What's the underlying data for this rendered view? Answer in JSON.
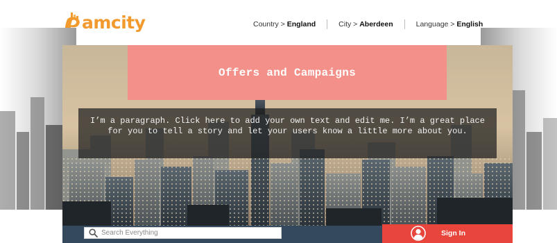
{
  "brand": {
    "logo_text": "amcity",
    "logo_initial": "P",
    "color": "#f29a2e"
  },
  "topnav": {
    "country": {
      "label": "Country > ",
      "value": "England"
    },
    "city": {
      "label": "City > ",
      "value": "Aberdeen"
    },
    "language": {
      "label": "Language > ",
      "value": "English"
    }
  },
  "hero": {
    "title": "Offers and Campaigns",
    "paragraph": "I’m a paragraph. Click here to add your own text and edit me. I’m a great place for you to tell a story and let your users know a little more about you.",
    "banner_color": "#f39089"
  },
  "search": {
    "placeholder": "Search Everything",
    "icon": "search-icon"
  },
  "signin": {
    "label": "Sign In",
    "icon": "user-avatar-icon",
    "color": "#e8453c"
  },
  "bottombar_color": "#34495e"
}
